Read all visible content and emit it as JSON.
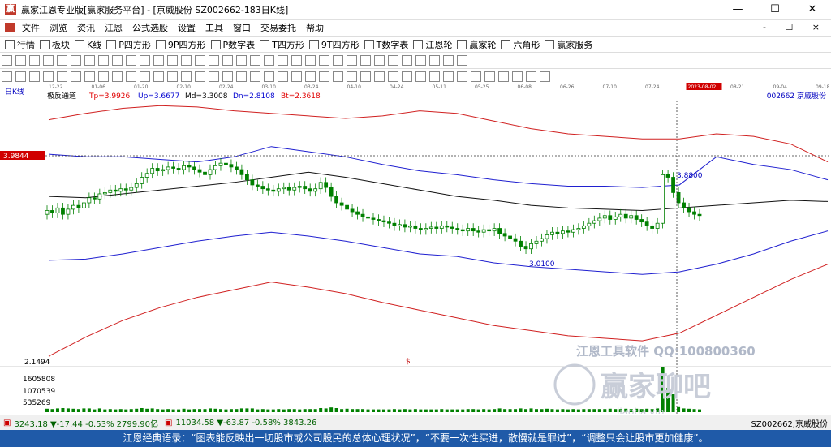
{
  "window": {
    "title": "赢家江恩专业版[赢家服务平台] - [京威股份   SZ002662-183日K线]",
    "min": "—",
    "max": "☐",
    "close": "✕"
  },
  "menu": {
    "items": [
      "文件",
      "浏览",
      "资讯",
      "江恩",
      "公式选股",
      "设置",
      "工具",
      "窗口",
      "交易委托",
      "帮助"
    ],
    "mdi": "- ☐ ×"
  },
  "toolbar1": [
    "行情",
    "板块",
    "K线",
    "P四方形",
    "9P四方形",
    "P数字表",
    "T四方形",
    "9T四方形",
    "T数字表",
    "江恩轮",
    "赢家轮",
    "六角形",
    "赢家服务"
  ],
  "chart": {
    "period_label": "日K线",
    "indicator_name": "极反通道",
    "params": [
      {
        "label": "Tp=3.9926",
        "color": "#e00000"
      },
      {
        "label": "Up=3.6677",
        "color": "#0000d0"
      },
      {
        "label": "Md=3.3008",
        "color": "#000000"
      },
      {
        "label": "Dn=2.8108",
        "color": "#0000d0"
      },
      {
        "label": "Bt=2.3618",
        "color": "#e00000"
      }
    ],
    "stock_code": "002662 京威股份",
    "price_marker": "3.9844",
    "high_label": "3.8800",
    "low_label": "3.0100",
    "bottom_price": "2.1494",
    "dollar_mark": "$",
    "date_cursor": "2023-08-02",
    "dates": [
      "12-22",
      "01-06",
      "01-20",
      "02-10",
      "02-24",
      "03-10",
      "03-24",
      "04-10",
      "04-24",
      "05-11",
      "05-25",
      "06-08",
      "06-26",
      "07-10",
      "07-24",
      "2023-08-02",
      "08-21",
      "09-04",
      "09-18"
    ],
    "volume_labels": [
      "1605808",
      "1070539",
      "535269"
    ],
    "watermark_line1": "江恩工具软件  QQ:100800360",
    "watermark_line2": "赢家聊吧",
    "watermark_line3": "jiaoba.vip"
  },
  "chart_data": {
    "type": "candlestick",
    "indicator": "极反通道",
    "ylim": [
      2.1494,
      4.2
    ],
    "levels": {
      "Tp": 3.9926,
      "Up": 3.6677,
      "Md": 3.3008,
      "Dn": 2.8108,
      "Bt": 2.3618
    },
    "annotations": [
      {
        "label": "3.8800",
        "value": 3.88
      },
      {
        "label": "3.0100",
        "value": 3.01
      }
    ],
    "closes": [
      3.34,
      3.32,
      3.36,
      3.31,
      3.35,
      3.38,
      3.36,
      3.4,
      3.44,
      3.43,
      3.47,
      3.48,
      3.5,
      3.49,
      3.51,
      3.5,
      3.52,
      3.55,
      3.6,
      3.63,
      3.67,
      3.65,
      3.66,
      3.68,
      3.67,
      3.66,
      3.69,
      3.68,
      3.66,
      3.64,
      3.62,
      3.66,
      3.69,
      3.71,
      3.7,
      3.68,
      3.66,
      3.62,
      3.58,
      3.54,
      3.53,
      3.51,
      3.5,
      3.49,
      3.51,
      3.52,
      3.5,
      3.52,
      3.53,
      3.51,
      3.49,
      3.51,
      3.56,
      3.52,
      3.45,
      3.4,
      3.38,
      3.35,
      3.33,
      3.31,
      3.29,
      3.28,
      3.27,
      3.26,
      3.25,
      3.24,
      3.22,
      3.23,
      3.21,
      3.22,
      3.2,
      3.19,
      3.2,
      3.21,
      3.2,
      3.22,
      3.21,
      3.2,
      3.19,
      3.18,
      3.2,
      3.18,
      3.17,
      3.19,
      3.18,
      3.2,
      3.16,
      3.14,
      3.12,
      3.1,
      3.06,
      3.04,
      3.08,
      3.1,
      3.12,
      3.15,
      3.17,
      3.16,
      3.18,
      3.17,
      3.19,
      3.2,
      3.22,
      3.24,
      3.26,
      3.28,
      3.3,
      3.27,
      3.29,
      3.31,
      3.28,
      3.3,
      3.27,
      3.25,
      3.22,
      3.2,
      3.24,
      3.62,
      3.6,
      3.48,
      3.4,
      3.36,
      3.33,
      3.31,
      3.3
    ],
    "channel_top": [
      4.05,
      4.1,
      4.14,
      4.16,
      4.15,
      4.12,
      4.1,
      4.08,
      4.06,
      4.08,
      4.12,
      4.1,
      4.04,
      3.98,
      3.94,
      3.92,
      3.9,
      3.9,
      3.94,
      3.92,
      3.86,
      3.72
    ],
    "channel_up": [
      3.78,
      3.76,
      3.76,
      3.74,
      3.72,
      3.76,
      3.84,
      3.8,
      3.76,
      3.7,
      3.65,
      3.62,
      3.58,
      3.55,
      3.53,
      3.53,
      3.52,
      3.54,
      3.76,
      3.7,
      3.66,
      3.58
    ],
    "channel_mid": [
      3.45,
      3.44,
      3.47,
      3.5,
      3.53,
      3.56,
      3.6,
      3.64,
      3.6,
      3.55,
      3.5,
      3.45,
      3.42,
      3.38,
      3.36,
      3.35,
      3.34,
      3.36,
      3.38,
      3.4,
      3.42,
      3.41
    ],
    "channel_dn": [
      2.95,
      2.96,
      3.0,
      3.05,
      3.1,
      3.14,
      3.17,
      3.14,
      3.1,
      3.05,
      3.0,
      2.98,
      2.93,
      2.9,
      2.88,
      2.86,
      2.84,
      2.86,
      2.92,
      3.0,
      3.1,
      3.18
    ],
    "channel_bt": [
      2.2,
      2.35,
      2.48,
      2.58,
      2.66,
      2.72,
      2.78,
      2.74,
      2.69,
      2.62,
      2.56,
      2.5,
      2.44,
      2.4,
      2.36,
      2.34,
      2.32,
      2.38,
      2.52,
      2.66,
      2.8,
      2.92
    ]
  },
  "status": {
    "sh": "3243.18  ▼-17.44  -0.53%  2799.90亿",
    "sz": "11034.58  ▼-63.87  -0.58%  3843.26",
    "stock": "SZ002662,京威股份"
  },
  "footer": "江恩经典语录：“图表能反映出一切股市或公司股民的总体心理状况”，“不要一次性买进，散慢就是罪过”，“调整只会让股市更加健康”。"
}
